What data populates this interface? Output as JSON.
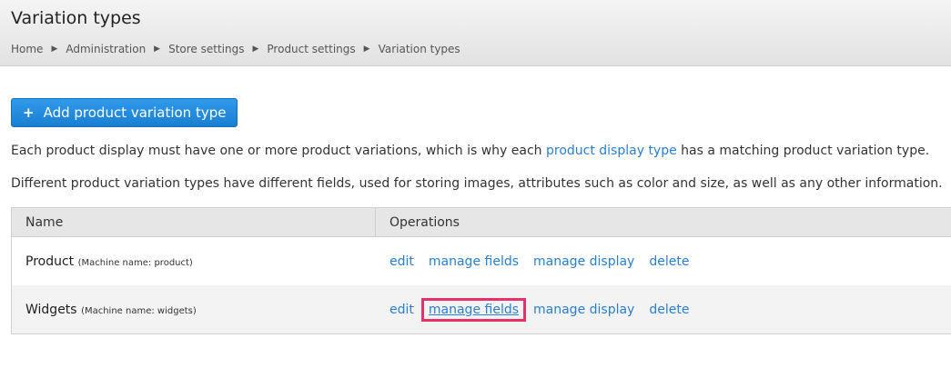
{
  "page": {
    "title": "Variation types"
  },
  "breadcrumb": [
    "Home",
    "Administration",
    "Store settings",
    "Product settings",
    "Variation types"
  ],
  "actions": {
    "add_label": "Add product variation type",
    "add_icon": "plus-icon"
  },
  "description": {
    "line1_before": "Each product display must have one or more product variations, which is why each ",
    "line1_link": "product display type",
    "line1_after": " has a matching product variation type.",
    "line2": "Different product variation types have different fields, used for storing images, attributes such as color and size, as well as any other information."
  },
  "table": {
    "headers": {
      "name": "Name",
      "operations": "Operations"
    },
    "rows": [
      {
        "name": "Product",
        "machine": "(Machine name: product)",
        "ops": [
          "edit",
          "manage fields",
          "manage display",
          "delete"
        ]
      },
      {
        "name": "Widgets",
        "machine": "(Machine name: widgets)",
        "ops": [
          "edit",
          "manage fields",
          "manage display",
          "delete"
        ]
      }
    ]
  },
  "colors": {
    "link": "#2a7fd0",
    "button": "#1b7fd1",
    "highlight": "#e8306a"
  }
}
